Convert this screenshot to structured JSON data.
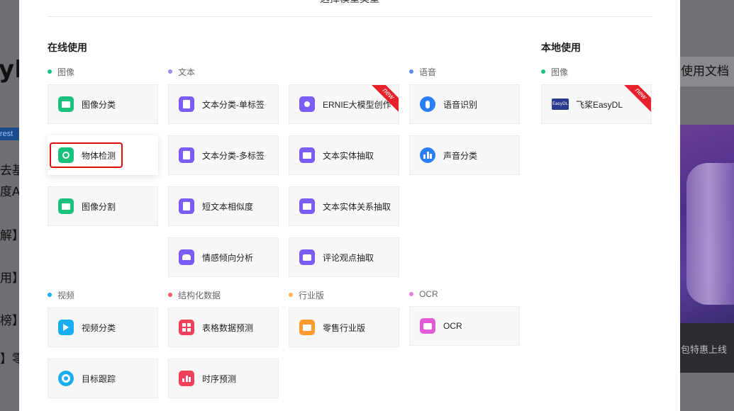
{
  "modal_title": "选择模型类型",
  "sections": {
    "online": "在线使用",
    "local": "本地使用"
  },
  "categories": {
    "image": "图像",
    "text": "文本",
    "speech": "语音",
    "local_image": "图像",
    "video": "视频",
    "structured": "结构化数据",
    "industry": "行业版",
    "ocr": "OCR"
  },
  "cards": {
    "image_classification": "图像分类",
    "object_detection": "物体检测",
    "image_segmentation": "图像分割",
    "text_single_label": "文本分类-单标签",
    "text_multi_label": "文本分类-多标签",
    "short_text_similarity": "短文本相似度",
    "sentiment": "情感倾向分析",
    "ernie": "ERNIE大模型创作",
    "entity_extraction": "文本实体抽取",
    "entity_relation": "文本实体关系抽取",
    "opinion_extraction": "评论观点抽取",
    "speech_recognition": "语音识别",
    "sound_classification": "声音分类",
    "paddle_easydl": "飞桨EasyDL",
    "video_classification": "视频分类",
    "object_tracking": "目标跟踪",
    "table_prediction": "表格数据预测",
    "time_series": "时序预测",
    "retail": "零售行业版",
    "ocr": "OCR"
  },
  "badges": {
    "new": "new",
    "easydl_logo": "EasyDL"
  },
  "background": {
    "left_big": "yDL",
    "left_tag": "rest",
    "left_lines": [
      "去基",
      "度A",
      "解】E",
      "用】新",
      "榜】E",
      "】零"
    ],
    "right_title": "使用文档",
    "right_bar": "包特惠上线"
  },
  "colors": {
    "green": "#19c27c",
    "purple": "#7b5cf5",
    "blue": "#2c7ef8",
    "cyan": "#1aaef0",
    "red": "#f0405a",
    "orange": "#ff9a2e",
    "pink": "#e45bd6",
    "highlight": "#e01010",
    "new_ribbon": "#e8202a"
  }
}
